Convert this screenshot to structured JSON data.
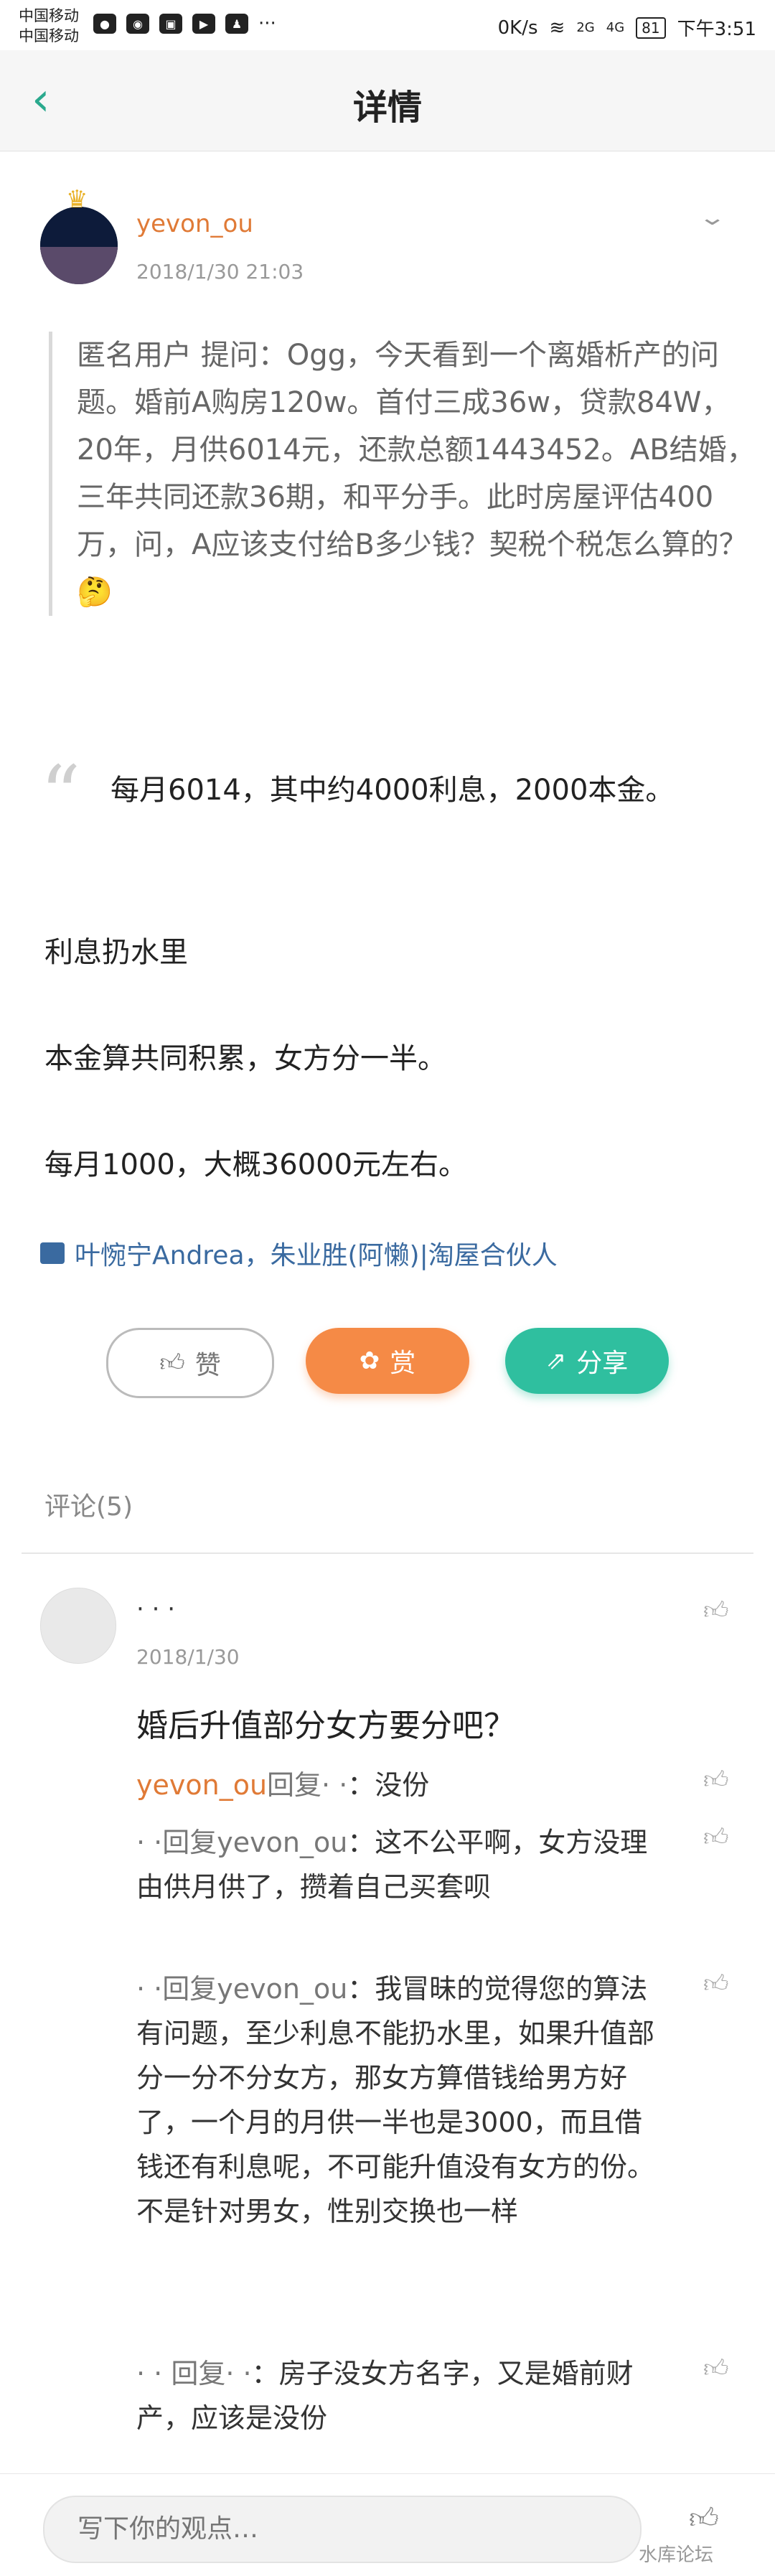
{
  "status_bar": {
    "carrier1": "中国移动",
    "carrier2": "中国移动",
    "network_speed": "0K/s",
    "signal1": "2G",
    "signal2": "4G",
    "battery": "81",
    "time": "下午3:51"
  },
  "header": {
    "title": "详情"
  },
  "post": {
    "username": "yevon_ou",
    "date": "2018/1/30 21:03",
    "question": "匿名用户 提问：Ogg，今天看到一个离婚析产的问题。婚前A购房120w。首付三成36w，贷款84W，20年，月供6014元，还款总额1443452。AB结婚，三年共同还款36期，和平分手。此时房屋评估400万，问，A应该支付给B多少钱？契税个税怎么算的？",
    "emoji": "🤔",
    "answer_lines": [
      "每月6014，其中约4000利息，2000本金。",
      "利息扔水里",
      "本金算共同积累，女方分一半。",
      "每月1000，大概36000元左右。"
    ],
    "likers": "叶惋宁Andrea，朱业胜(阿懒)|淘屋合伙人"
  },
  "actions": {
    "like_label": "赞",
    "reward_label": "赏",
    "share_label": "分享"
  },
  "comments": {
    "header": "评论(5)",
    "first": {
      "date": "2018/1/30",
      "text": "婚后升值部分女方要分吧？"
    },
    "replies": [
      {
        "name": "yevon_ou",
        "action": "回复",
        "text": "：没份"
      },
      {
        "action": "回复yevon_ou",
        "text": "：这不公平啊，女方没理由供月供了，攒着自己买套呗"
      },
      {
        "action": "回复yevon_ou",
        "text": "：我冒昧的觉得您的算法有问题，至少利息不能扔水里，如果升值部分一分不分女方，那女方算借钱给男方好了，一个月的月供一半也是3000，而且借钱还有利息呢，不可能升值没有女方的份。不是针对男女，性别交换也一样"
      },
      {
        "action": "回复",
        "text": "：房子没女方名字，又是婚前财产，应该是没份"
      }
    ]
  },
  "footer": {
    "input_placeholder": "写下你的观点…",
    "watermark": "水库论坛"
  }
}
